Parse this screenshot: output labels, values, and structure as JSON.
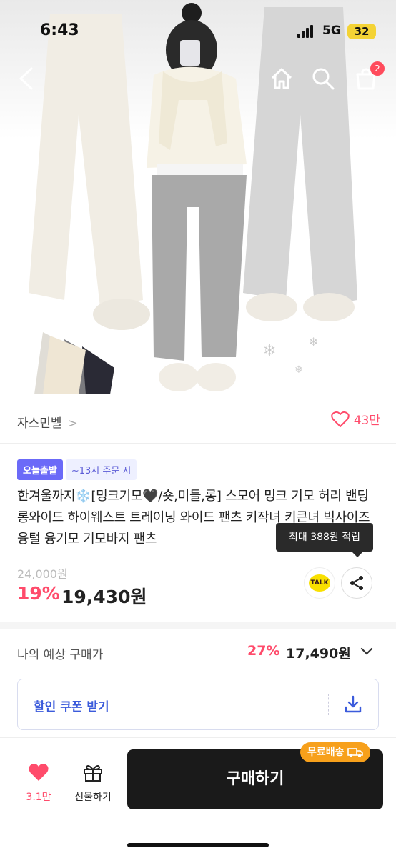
{
  "status": {
    "time": "6:43",
    "network": "5G",
    "battery": "32"
  },
  "cart_count": "2",
  "seller": {
    "name": "자스민벨",
    "chevron": ">"
  },
  "likes": {
    "count": "43만"
  },
  "badges": {
    "today_ship": "오늘출발",
    "order_time": "~13시 주문 시"
  },
  "product": {
    "title": "한겨울까지❄️[밍크기모🖤/숏,미들,롱] 스모어 밍크 기모 허리 밴딩 롱와이드 하이웨스트 트레이닝 와이드 팬츠 키작녀 키큰녀 빅사이즈 융털 융기모 기모바지 팬츠",
    "original_price": "24,000원",
    "discount": "19%",
    "price": "19,430원"
  },
  "tooltip": "최대 388원 적립",
  "talk_label": "TALK",
  "estimate": {
    "label": "나의 예상 구매가",
    "discount": "27%",
    "price": "17,490원"
  },
  "coupon": {
    "label": "할인 쿠폰 받기"
  },
  "bottom": {
    "wish_count": "3.1만",
    "gift_label": "선물하기",
    "buy_label": "구매하기",
    "free_ship": "무료배송"
  },
  "colors": {
    "accent_pink": "#ff4b6b",
    "coupon_blue": "#3b5bdb",
    "badge_purple": "#6b6af8",
    "free_ship_orange": "#f7a01b"
  }
}
